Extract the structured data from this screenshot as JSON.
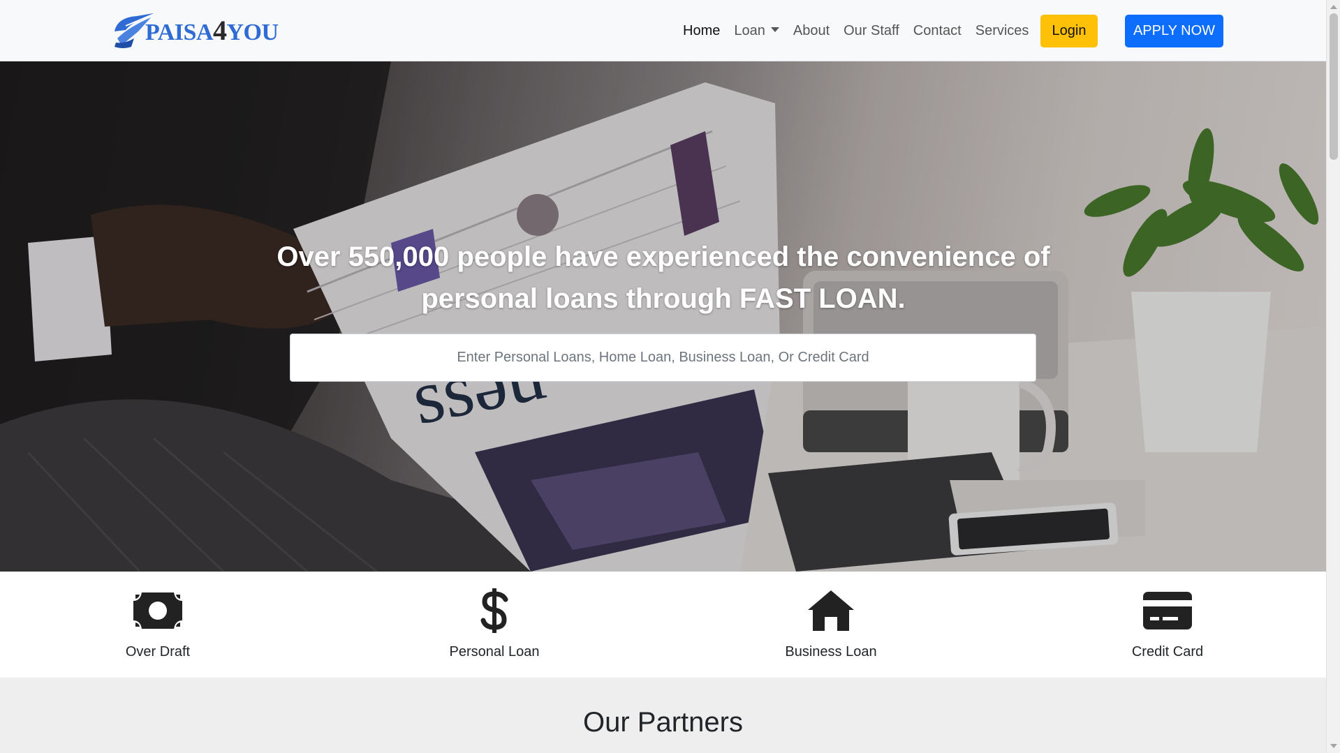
{
  "brand": {
    "name_part1": "PAISA",
    "name_part2": "4",
    "name_part3": "YOU",
    "logo_icon": "paper-plane-logo-icon",
    "color_primary": "#2f6bd4"
  },
  "nav": {
    "items": [
      {
        "label": "Home",
        "active": true
      },
      {
        "label": "Loan",
        "dropdown": true
      },
      {
        "label": "About"
      },
      {
        "label": "Our Staff"
      },
      {
        "label": "Contact"
      },
      {
        "label": "Services"
      }
    ],
    "login_label": "Login",
    "apply_label": "APPLY NOW",
    "login_color": "#ffc107",
    "apply_color": "#0d6efd"
  },
  "hero": {
    "title": "Over 550,000 people have experienced the convenience of personal loans through FAST LOAN.",
    "search_placeholder": "Enter Personal Loans, Home Loan, Business Loan, Or Credit Card",
    "search_value": ""
  },
  "services": [
    {
      "label": "Over Draft",
      "icon": "money-bill-icon"
    },
    {
      "label": "Personal Loan",
      "icon": "dollar-sign-icon"
    },
    {
      "label": "Business Loan",
      "icon": "house-icon"
    },
    {
      "label": "Credit Card",
      "icon": "credit-card-icon"
    }
  ],
  "partners": {
    "heading": "Our Partners"
  }
}
